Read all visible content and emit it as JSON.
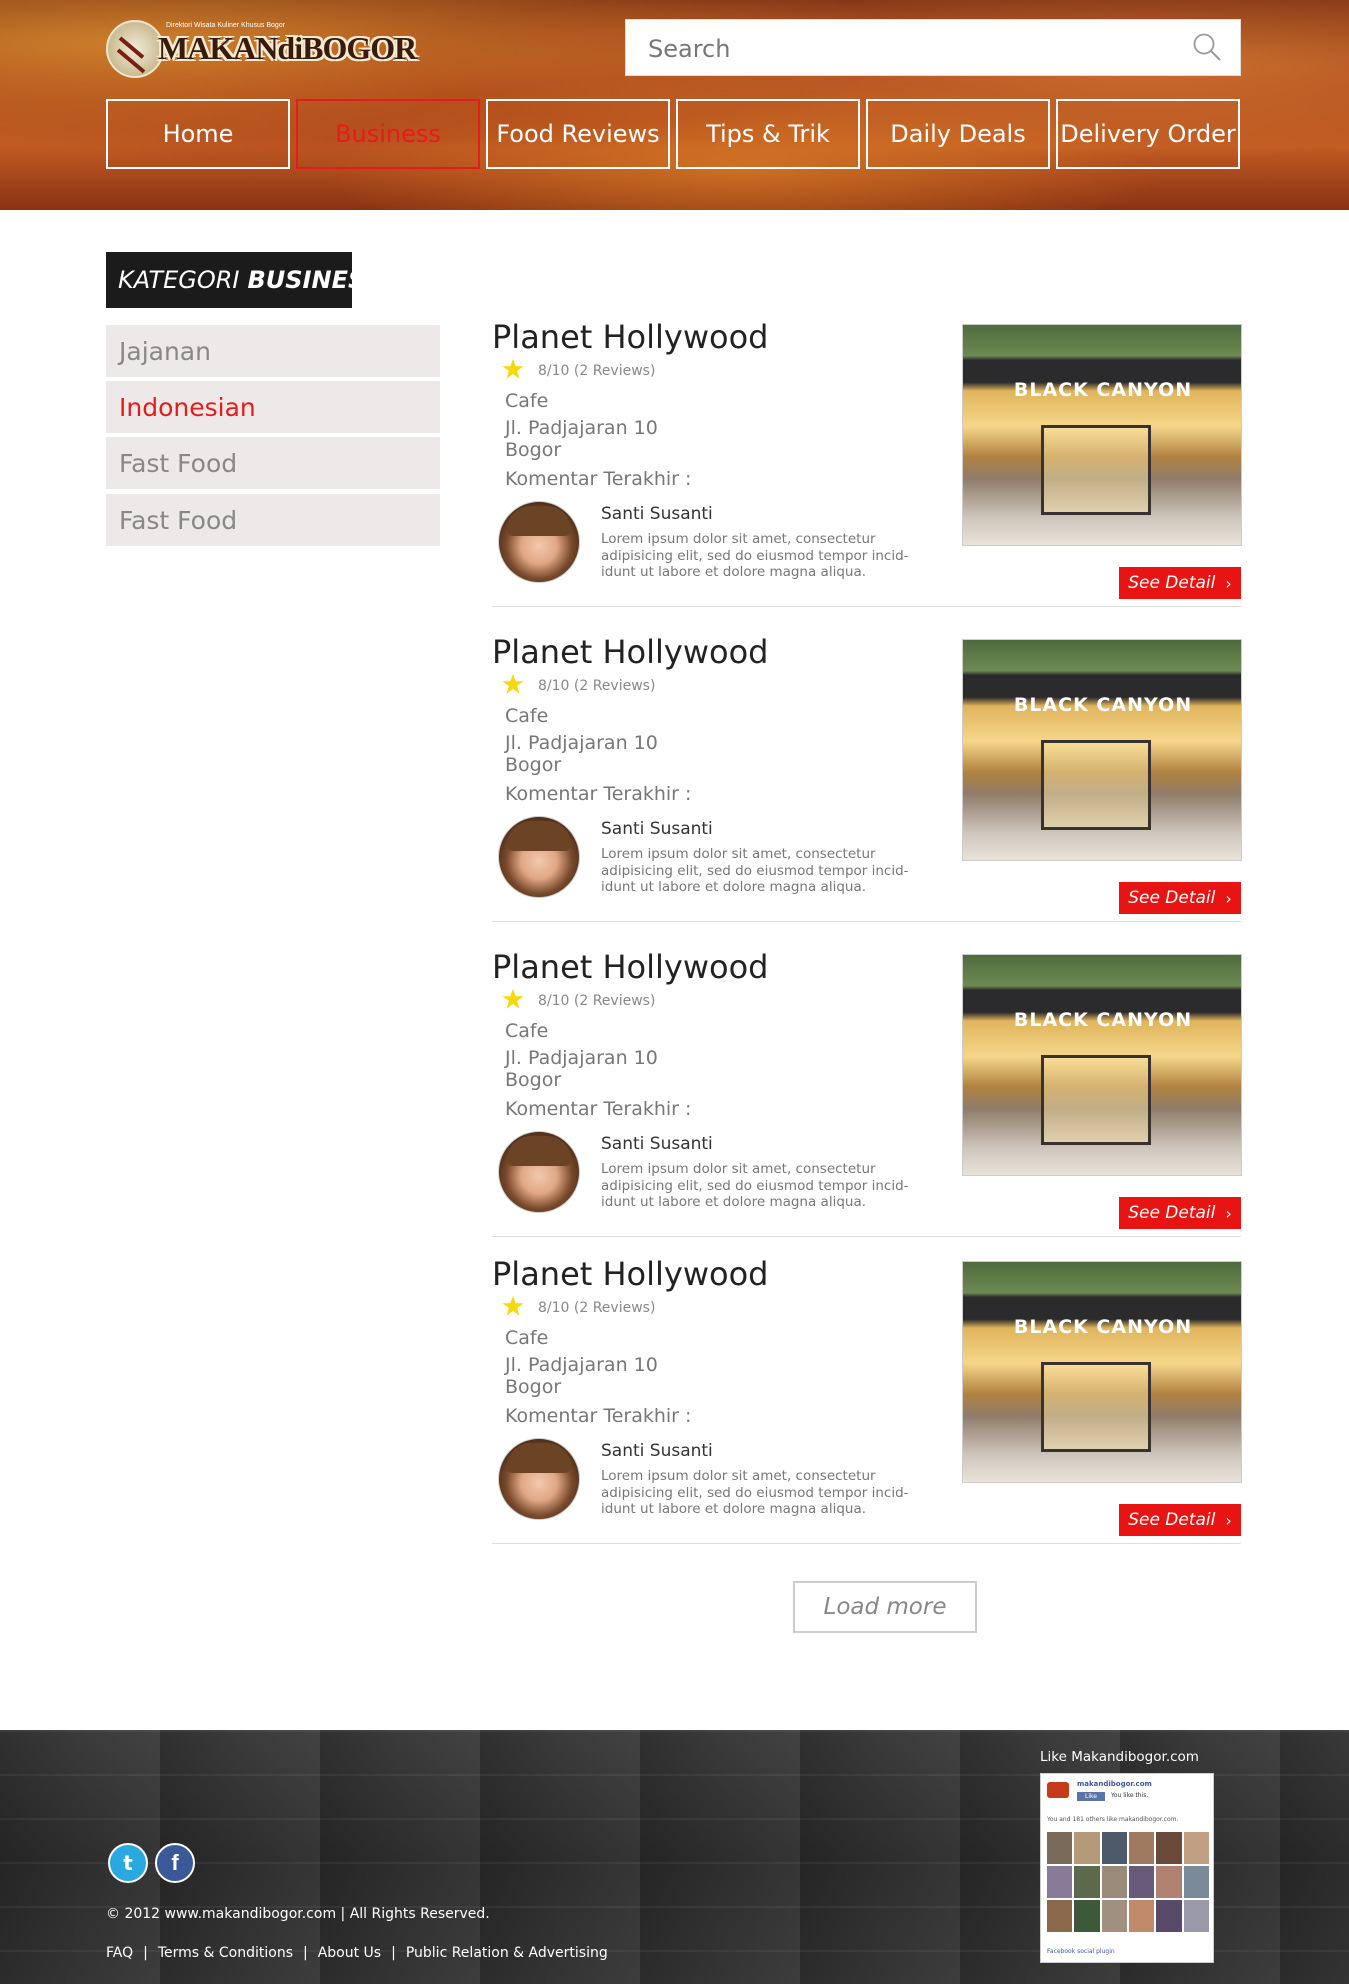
{
  "brand": {
    "logo_tagline": "Direktori Wisata Kuliner Khusus Bogor",
    "logo_text": "MAKANdiBOGOR"
  },
  "search": {
    "placeholder": "Search"
  },
  "nav": [
    {
      "label": "Home",
      "active": false
    },
    {
      "label": "Business",
      "active": true
    },
    {
      "label": "Food Reviews",
      "active": false
    },
    {
      "label": "Tips & Trik",
      "active": false
    },
    {
      "label": "Daily Deals",
      "active": false
    },
    {
      "label": "Delivery Order",
      "active": false
    }
  ],
  "sidebar": {
    "title_prefix": "KATEGORI",
    "title_bold": "BUSINESS",
    "items": [
      {
        "label": "Jajanan",
        "active": false
      },
      {
        "label": "Indonesian",
        "active": true
      },
      {
        "label": "Fast Food",
        "active": false
      },
      {
        "label": "Fast Food",
        "active": false
      }
    ]
  },
  "listings": [
    {
      "name": "Planet Hollywood",
      "rating": "8/10 (2 Reviews)",
      "type": "Cafe",
      "address_line1": "Jl. Padjajaran 10",
      "address_line2": "Bogor",
      "comment_label": "Komentar Terakhir :",
      "commenter": "Santi Susanti",
      "comment": "Lorem ipsum dolor sit amet, consectetur adipisicing elit, sed do eiusmod tempor incid-idunt ut labore et dolore magna aliqua.",
      "photo_sign": "BLACK CANYON",
      "button": "See Detail"
    },
    {
      "name": "Planet Hollywood",
      "rating": "8/10 (2 Reviews)",
      "type": "Cafe",
      "address_line1": "Jl. Padjajaran 10",
      "address_line2": "Bogor",
      "comment_label": "Komentar Terakhir :",
      "commenter": "Santi Susanti",
      "comment": "Lorem ipsum dolor sit amet, consectetur adipisicing elit, sed do eiusmod tempor incid-idunt ut labore et dolore magna aliqua.",
      "photo_sign": "BLACK CANYON",
      "button": "See Detail"
    },
    {
      "name": "Planet Hollywood",
      "rating": "8/10 (2 Reviews)",
      "type": "Cafe",
      "address_line1": "Jl. Padjajaran 10",
      "address_line2": "Bogor",
      "comment_label": "Komentar Terakhir :",
      "commenter": "Santi Susanti",
      "comment": "Lorem ipsum dolor sit amet, consectetur adipisicing elit, sed do eiusmod tempor incid-idunt ut labore et dolore magna aliqua.",
      "photo_sign": "BLACK CANYON",
      "button": "See Detail"
    },
    {
      "name": "Planet Hollywood",
      "rating": "8/10 (2 Reviews)",
      "type": "Cafe",
      "address_line1": "Jl. Padjajaran 10",
      "address_line2": "Bogor",
      "comment_label": "Komentar Terakhir :",
      "commenter": "Santi Susanti",
      "comment": "Lorem ipsum dolor sit amet, consectetur adipisicing elit, sed do eiusmod tempor incid-idunt ut labore et dolore magna aliqua.",
      "photo_sign": "BLACK CANYON",
      "button": "See Detail"
    }
  ],
  "load_more": "Load more",
  "footer": {
    "copyright": "© 2012 www.makandibogor.com | All Rights Reserved.",
    "links": [
      "FAQ",
      "Terms & Conditions",
      "About Us",
      "Public Relation & Advertising"
    ],
    "like_label": "Like Makandibogor.com",
    "widget": {
      "page_name": "makandibogor.com",
      "like_button": "Like",
      "you_like": "You like this.",
      "others": "You and 181 others like makandibogor.com.",
      "plugin": "Facebook social plugin"
    },
    "social": [
      {
        "icon": "twitter-icon",
        "glyph": "t"
      },
      {
        "icon": "facebook-icon",
        "glyph": "f"
      }
    ]
  },
  "colors": {
    "accent": "#e61b1b",
    "sidebar_bg": "#ece9e8",
    "title_bg": "#1b1b1b"
  }
}
